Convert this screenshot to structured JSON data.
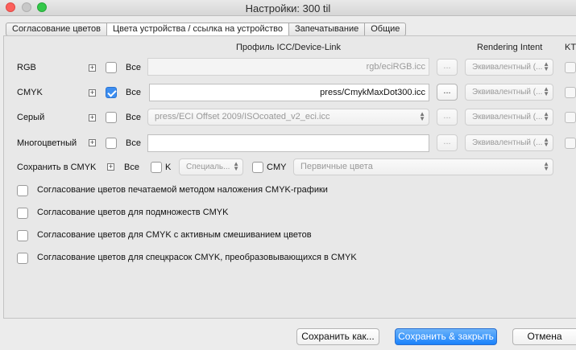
{
  "window": {
    "title": "Настройки:  300 til"
  },
  "tabs": [
    {
      "label": "Согласование цветов"
    },
    {
      "label": "Цвета устройства / ссылка на устройство"
    },
    {
      "label": "Запечатывание"
    },
    {
      "label": "Общие"
    }
  ],
  "columns": {
    "profile": "Профиль ICC/Device-Link",
    "intent": "Rendering Intent",
    "kt": "KT"
  },
  "rows": [
    {
      "name": "RGB",
      "all": "Все",
      "profile": "rgb/eciRGB.icc",
      "intent": "Эквивалентный (...",
      "checked": false
    },
    {
      "name": "CMYK",
      "all": "Все",
      "profile": "press/CmykMaxDot300.icc",
      "intent": "Эквивалентный (...",
      "checked": true
    },
    {
      "name": "Серый",
      "all": "Все",
      "profile": "press/ECI Offset 2009/ISOcoated_v2_eci.icc",
      "intent": "Эквивалентный (...",
      "checked": false
    },
    {
      "name": "Многоцветный",
      "all": "Все",
      "profile": "",
      "intent": "Эквивалентный (...",
      "checked": false
    }
  ],
  "preserve": {
    "label": "Сохранить в CMYK",
    "all": "Все",
    "k_label": "K",
    "k_select": "Специаль...",
    "cmy_label": "CMY",
    "cmy_select": "Первичные цвета"
  },
  "options": [
    {
      "label": "Согласование цветов печатаемой методом наложения CMYK-графики"
    },
    {
      "label": "Согласование цветов для подмножеств CMYK"
    },
    {
      "label": "Согласование цветов для CMYK с активным смешиванием цветов"
    },
    {
      "label": "Согласование цветов для спецкрасок CMYK, преобразовывающихся в CMYK"
    }
  ],
  "plus_glyph": "+",
  "dots_glyph": "...",
  "buttons": {
    "save_as": "Сохранить как...",
    "save_close": "Сохранить & закрыть",
    "cancel": "Отмена"
  },
  "colors": {
    "accent": "#1a82fb",
    "checkbox_checked": "#3d8ef0"
  }
}
